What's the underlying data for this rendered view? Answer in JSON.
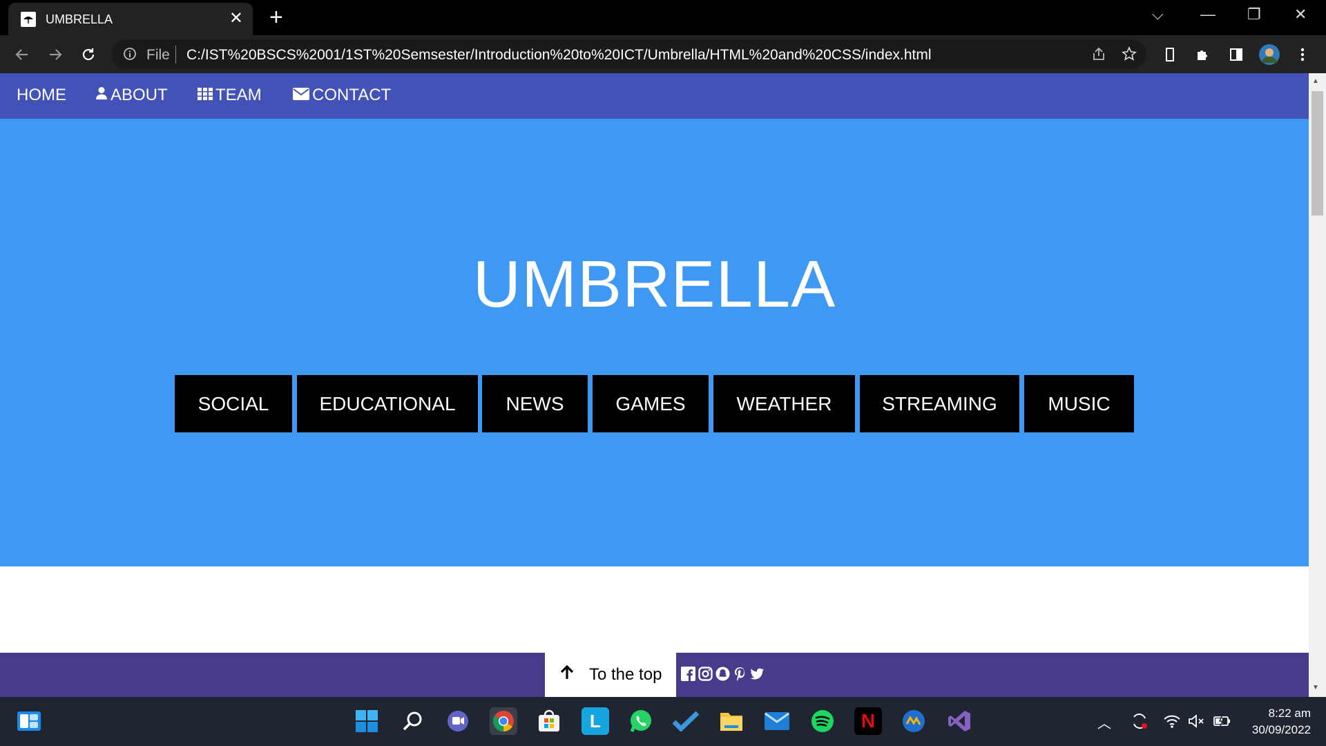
{
  "browser": {
    "tab_title": "UMBRELLA",
    "tab_close": "✕",
    "new_tab": "+",
    "window_controls": {
      "dropdown": "⌵",
      "minimize": "—",
      "restore": "❐",
      "close": "✕"
    },
    "omnibox_scheme": "File",
    "url": "C:/IST%20BSCS%2001/1ST%20Semsester/Introduction%20to%20ICT/Umbrella/HTML%20and%20CSS/index.html"
  },
  "page": {
    "nav": [
      {
        "label": "HOME",
        "icon": ""
      },
      {
        "label": "ABOUT",
        "icon": "user-icon"
      },
      {
        "label": "TEAM",
        "icon": "grid-icon"
      },
      {
        "label": "CONTACT",
        "icon": "envelope-icon"
      }
    ],
    "hero_title": "UMBRELLA",
    "categories": [
      "SOCIAL",
      "EDUCATIONAL",
      "NEWS",
      "GAMES",
      "WEATHER",
      "STREAMING",
      "MUSIC"
    ],
    "to_top_label": "To the top",
    "social_icons": [
      "facebook-icon",
      "instagram-icon",
      "snapchat-icon",
      "pinterest-icon",
      "twitter-icon"
    ],
    "colors": {
      "nav_bg": "#4352b7",
      "hero_bg": "#3f99f2",
      "footer_bg": "#473c8b",
      "button_bg": "#000000"
    }
  },
  "taskbar": {
    "apps": [
      "widgets",
      "start",
      "search",
      "teams-chat",
      "chrome",
      "microsoft-store",
      "l-app",
      "whatsapp",
      "todo",
      "file-explorer",
      "mail",
      "spotify",
      "netflix",
      "feather-app",
      "visual-studio"
    ],
    "time": "8:22 am",
    "date": "30/09/2022"
  }
}
